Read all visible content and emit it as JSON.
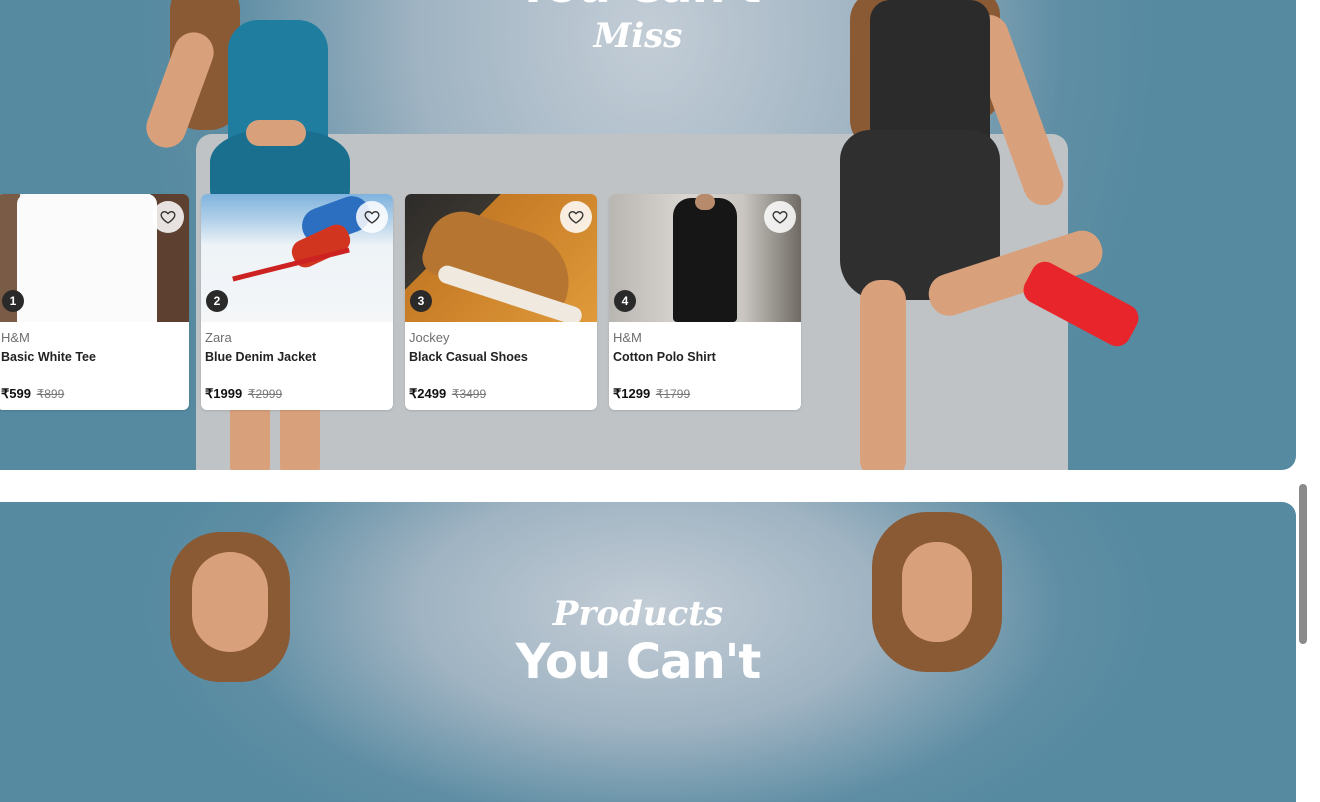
{
  "top_banner": {
    "heading_bold": "You Can't",
    "heading_italic": "Miss"
  },
  "products": [
    {
      "rank": "1",
      "brand": "H&M",
      "name": "Basic White Tee",
      "price": "₹599",
      "mrp": "₹899"
    },
    {
      "rank": "2",
      "brand": "Zara",
      "name": "Blue Denim Jacket",
      "price": "₹1999",
      "mrp": "₹2999"
    },
    {
      "rank": "3",
      "brand": "Jockey",
      "name": "Black Casual Shoes",
      "price": "₹2499",
      "mrp": "₹3499"
    },
    {
      "rank": "4",
      "brand": "H&M",
      "name": "Cotton Polo Shirt",
      "price": "₹1299",
      "mrp": "₹1799"
    }
  ],
  "bottom_banner": {
    "heading_italic": "Products",
    "heading_bold": "You Can't"
  },
  "icons": {
    "favorite": "heart-icon"
  },
  "colors": {
    "banner_edge": "#558aa0",
    "banner_center": "#c3cdd6",
    "rank_badge": "#2a2a2a"
  }
}
